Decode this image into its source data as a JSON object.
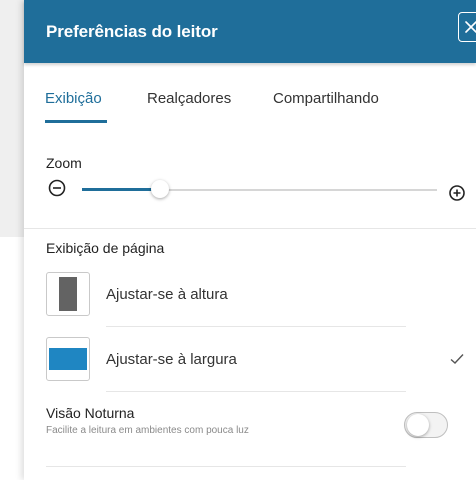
{
  "header": {
    "title": "Preferências do leitor",
    "close_icon": "close-icon"
  },
  "tabs": [
    {
      "label": "Exibição",
      "active": true
    },
    {
      "label": "Realçadores",
      "active": false
    },
    {
      "label": "Compartilhando",
      "active": false
    }
  ],
  "zoom": {
    "label": "Zoom",
    "level_fraction": 0.22,
    "minus_icon": "zoom-out-icon",
    "plus_icon": "zoom-in-icon"
  },
  "page_display": {
    "label": "Exibição de página",
    "options": [
      {
        "label": "Ajustar-se à altura",
        "icon": "fit-height-icon",
        "selected": false
      },
      {
        "label": "Ajustar-se à largura",
        "icon": "fit-width-icon",
        "selected": true
      }
    ]
  },
  "night_vision": {
    "title": "Visão Noturna",
    "subtitle": "Facilite a leitura em ambientes com pouca luz",
    "enabled": false
  },
  "colors": {
    "accent": "#1f6e9a",
    "fit_width_blue": "#1f86c2",
    "fit_height_gray": "#636363"
  }
}
